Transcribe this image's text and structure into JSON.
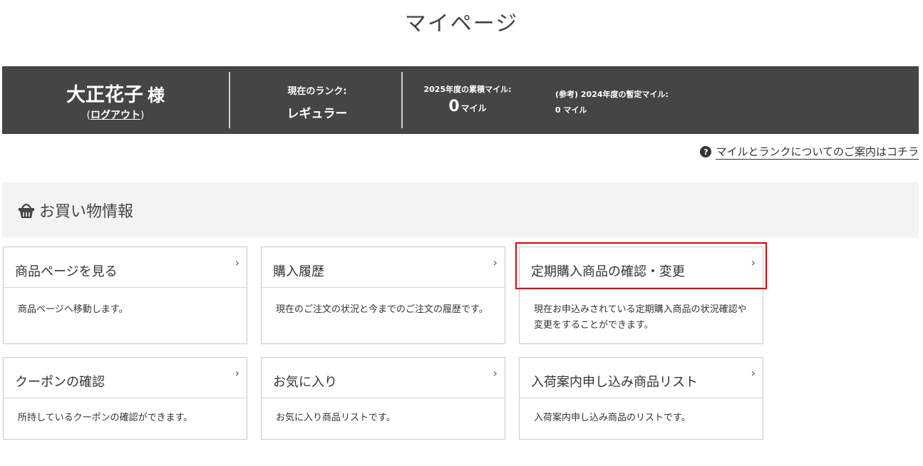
{
  "page": {
    "title": "マイページ"
  },
  "user": {
    "name": "大正花子",
    "honorific": "様",
    "logout_open": "(",
    "logout_label": "ログアウト",
    "logout_close": ")"
  },
  "rank": {
    "label": "現在のランク:",
    "value": "レギュラー"
  },
  "miles": {
    "label": "2025年度の累積マイル:",
    "value": "0",
    "unit": "マイル"
  },
  "ref_miles": {
    "label": "(参考) 2024年度の暫定マイル:",
    "value": "0 マイル"
  },
  "guide": {
    "icon": "question-circle-icon",
    "label": "マイルとランクについてのご案内はコチラ"
  },
  "section": {
    "icon": "shopping-basket-icon",
    "title": "お買い物情報"
  },
  "cards": [
    {
      "title": "商品ページを見る",
      "desc": "商品ページへ移動します。"
    },
    {
      "title": "購入履歴",
      "desc": "現在のご注文の状況と今までのご注文の履歴です。"
    },
    {
      "title": "定期購入商品の確認・変更",
      "desc": "現在お申込みされている定期購入商品の状況確認や変更をすることができます。"
    },
    {
      "title": "クーポンの確認",
      "desc": "所持しているクーポンの確認ができます。"
    },
    {
      "title": "お気に入り",
      "desc": "お気に入り商品リストです。"
    },
    {
      "title": "入荷案内申し込み商品リスト",
      "desc": "入荷案内申し込み商品のリストです。"
    }
  ],
  "chevron": "›",
  "colors": {
    "status_bar": "#454545",
    "highlight": "#e00000",
    "section_bg": "#f3f3f3"
  }
}
